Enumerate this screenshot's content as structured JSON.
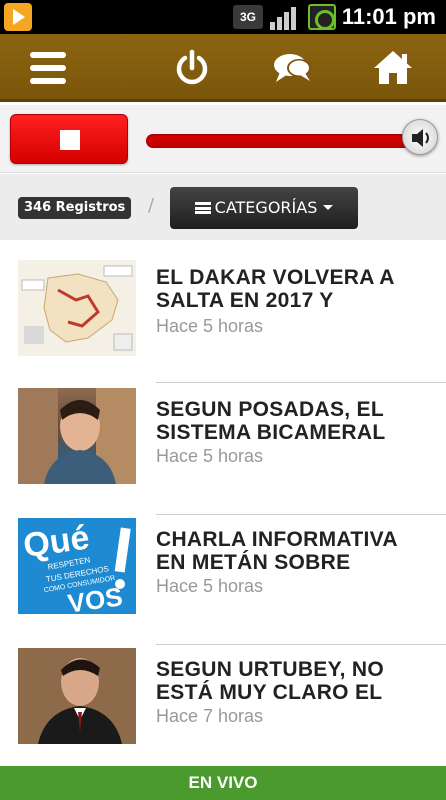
{
  "status_bar": {
    "network": "3G",
    "time": "11:01 pm"
  },
  "toolbar": {
    "icons": [
      "menu-icon",
      "power-icon",
      "chat-icon",
      "home-icon"
    ]
  },
  "player": {
    "volume_fraction": 0.96
  },
  "filters": {
    "registros": "346 Registros",
    "separator": "/",
    "categories_label": "CATEGORÍAS"
  },
  "news": [
    {
      "title": "EL DAKAR VOLVERA A SALTA EN 2017 Y",
      "time": "Hace 5 horas"
    },
    {
      "title": "SEGUN POSADAS, EL SISTEMA BICAMERAL",
      "time": "Hace 5 horas"
    },
    {
      "title": "CHARLA INFORMATIVA EN METÁN SOBRE",
      "time": "Hace 5 horas"
    },
    {
      "title": "SEGUN URTUBEY, NO ESTÁ MUY CLARO EL",
      "time": "Hace 7 horas"
    }
  ],
  "thumbnail_text": {
    "que": "Qué",
    "que_sub1": "RESPETEN",
    "que_sub2": "TUS DERECHOS",
    "que_sub3": "COMO CONSUMIDOR",
    "vos": "VOS"
  },
  "footer": {
    "label": "EN VIVO"
  },
  "colors": {
    "header": "#7a560b",
    "stop": "#e00000",
    "footer": "#4a9a2e"
  }
}
